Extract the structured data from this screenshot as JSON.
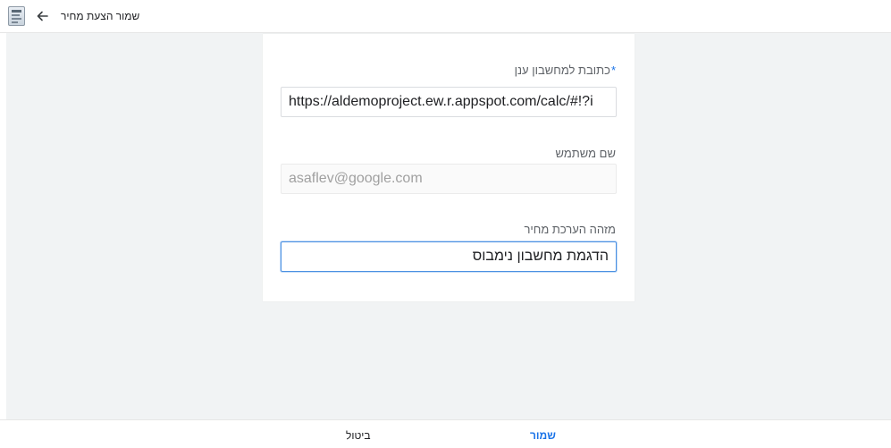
{
  "header": {
    "title": "שמור הצעת מחיר",
    "back_icon": "arrow-back-icon",
    "app_icon": "document-app-icon"
  },
  "form": {
    "cloud_url": {
      "label": "כתובת למחשבון ענן",
      "required_mark": "*",
      "value": "https://aldemoproject.ew.r.appspot.com/calc/#!?i"
    },
    "username": {
      "label": "שם משתמש",
      "value": "asaflev@google.com",
      "disabled": true
    },
    "estimate_id": {
      "label": "מזהה הערכת מחיר",
      "value": "הדגמת מחשבון נימבוס"
    }
  },
  "footer": {
    "cancel_label": "ביטול",
    "save_label": "שמור"
  },
  "colors": {
    "accent": "#1a73e8",
    "background": "#f1f3f4",
    "focus_border": "#4a90e2"
  }
}
